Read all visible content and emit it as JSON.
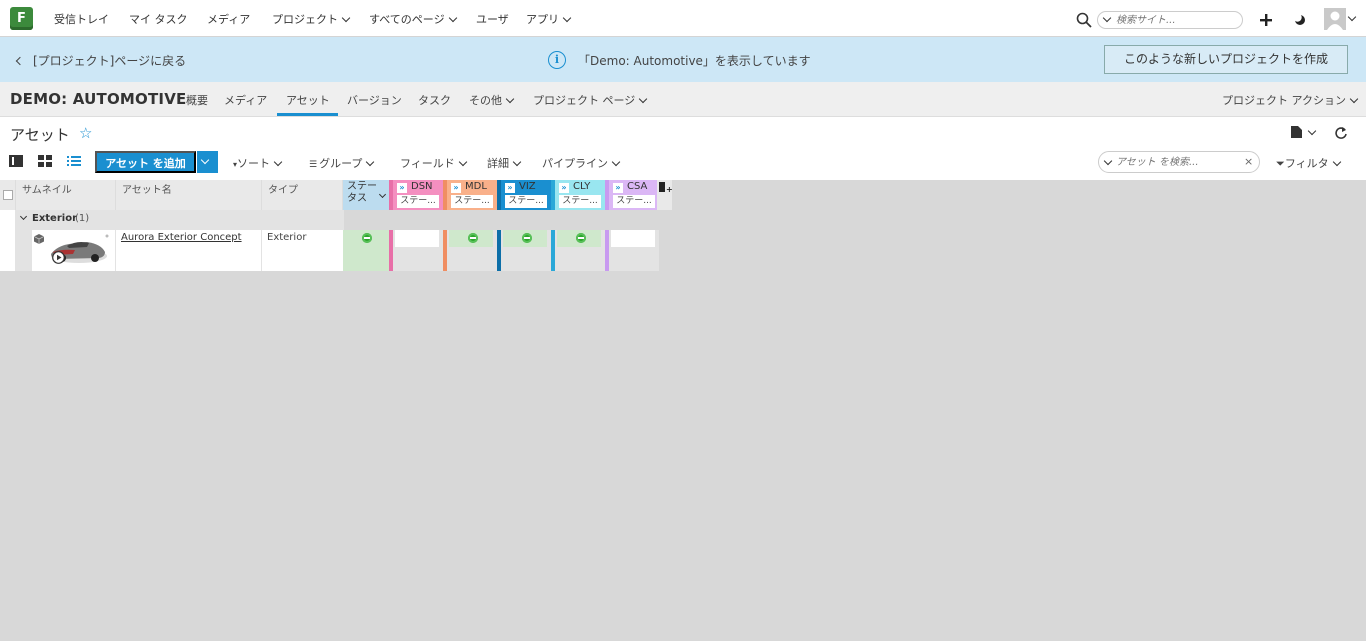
{
  "app": {
    "logo_letter": "F"
  },
  "topnav": {
    "items": [
      {
        "label": "受信トレイ"
      },
      {
        "label": "マイ タスク"
      },
      {
        "label": "メディア"
      },
      {
        "label": "プロジェクト",
        "dropdown": true
      },
      {
        "label": "すべてのページ",
        "dropdown": true
      },
      {
        "label": "ユーザ"
      },
      {
        "label": "アプリ",
        "dropdown": true
      }
    ],
    "search_placeholder": "検索サイト..."
  },
  "infobar": {
    "back_label": "[プロジェクト]ページに戻る",
    "message": "「Demo: Automotive」を表示しています",
    "create_button": "このような新しいプロジェクトを作成"
  },
  "project": {
    "title": "DEMO: AUTOMOTIVE",
    "tabs": [
      {
        "label": "概要"
      },
      {
        "label": "メディア"
      },
      {
        "label": "アセット",
        "active": true
      },
      {
        "label": "バージョン"
      },
      {
        "label": "タスク"
      },
      {
        "label": "その他",
        "dropdown": true
      },
      {
        "label": "プロジェクト ページ",
        "dropdown": true
      }
    ],
    "actions_label": "プロジェクト アクション"
  },
  "page": {
    "title": "アセット",
    "add_button": "アセット を追加",
    "toolbar": {
      "sort": "ソート",
      "group": "グループ",
      "fields": "フィールド",
      "details": "詳細",
      "pipeline": "パイプライン",
      "filter": "フィルタ"
    },
    "search_placeholder": "アセット を検索..."
  },
  "grid": {
    "columns": {
      "thumbnail": "サムネイル",
      "asset_name": "アセット名",
      "type": "タイプ",
      "status_line1": "ステー",
      "status_line2": "タス"
    },
    "pipeline_steps": [
      {
        "code": "DSN",
        "sub": "ステー...",
        "color": "#f48fc0",
        "bar": "#e86fa8"
      },
      {
        "code": "MDL",
        "sub": "ステー...",
        "color": "#f9b08a",
        "bar": "#f08e62"
      },
      {
        "code": "VIZ",
        "sub": "ステー...",
        "color": "#1a8fd0",
        "bar": "#0d6fa8"
      },
      {
        "code": "CLY",
        "sub": "ステー...",
        "color": "#99e6f0",
        "bar": "#2aa8d8"
      },
      {
        "code": "CSA",
        "sub": "ステー...",
        "color": "#dbb7f5",
        "bar": "#c89af0"
      }
    ],
    "group": {
      "label": "Exterior",
      "count": "(1)"
    },
    "rows": [
      {
        "asset_name": "Aurora Exterior Concept",
        "type": "Exterior"
      }
    ]
  }
}
